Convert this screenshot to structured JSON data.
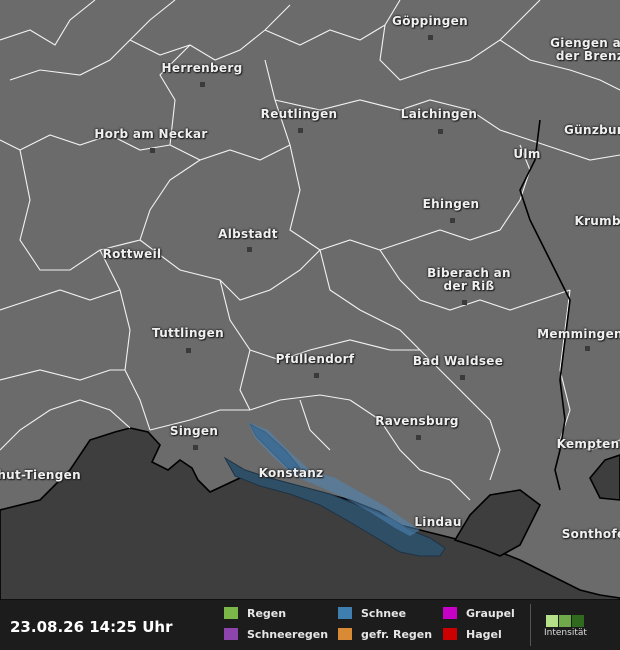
{
  "map": {
    "cities": [
      {
        "name": "Göppingen"
      },
      {
        "name": "Giengen an der Brenz"
      },
      {
        "name": "Herrenberg"
      },
      {
        "name": "Reutlingen"
      },
      {
        "name": "Laichingen"
      },
      {
        "name": "Günzburg"
      },
      {
        "name": "Horb am Neckar"
      },
      {
        "name": "Ulm"
      },
      {
        "name": "Ehingen"
      },
      {
        "name": "Krumbach"
      },
      {
        "name": "Albstadt"
      },
      {
        "name": "Rottweil"
      },
      {
        "name": "Biberach an der Riß"
      },
      {
        "name": "Tuttlingen"
      },
      {
        "name": "Memmingen"
      },
      {
        "name": "Pfullendorf"
      },
      {
        "name": "Bad Waldsee"
      },
      {
        "name": "Singen"
      },
      {
        "name": "Ravensburg"
      },
      {
        "name": "Kempten"
      },
      {
        "name": "Waldshut-Tiengen"
      },
      {
        "name": "Konstanz"
      },
      {
        "name": "Lindau"
      },
      {
        "name": "Sonthofen"
      }
    ],
    "colors": {
      "land": "#6b6b6b",
      "foreign": "#3e3e3e",
      "lake": "#2f4f66",
      "snow_overlay": "#4e86b8"
    }
  },
  "footer": {
    "timestamp": "23.08.26 14:25 Uhr",
    "legend": [
      {
        "label": "Regen",
        "color": "#7ab648"
      },
      {
        "label": "Schneeregen",
        "color": "#8e44ad"
      },
      {
        "label": "Schnee",
        "color": "#3f7fb0"
      },
      {
        "label": "gefr. Regen",
        "color": "#d98a35"
      },
      {
        "label": "Graupel",
        "color": "#c600c6"
      },
      {
        "label": "Hagel",
        "color": "#cc0000"
      }
    ],
    "intensity_label": "Intensität",
    "intensity_colors": [
      "#b5e08a",
      "#6fa94a",
      "#2f6a1e"
    ]
  }
}
